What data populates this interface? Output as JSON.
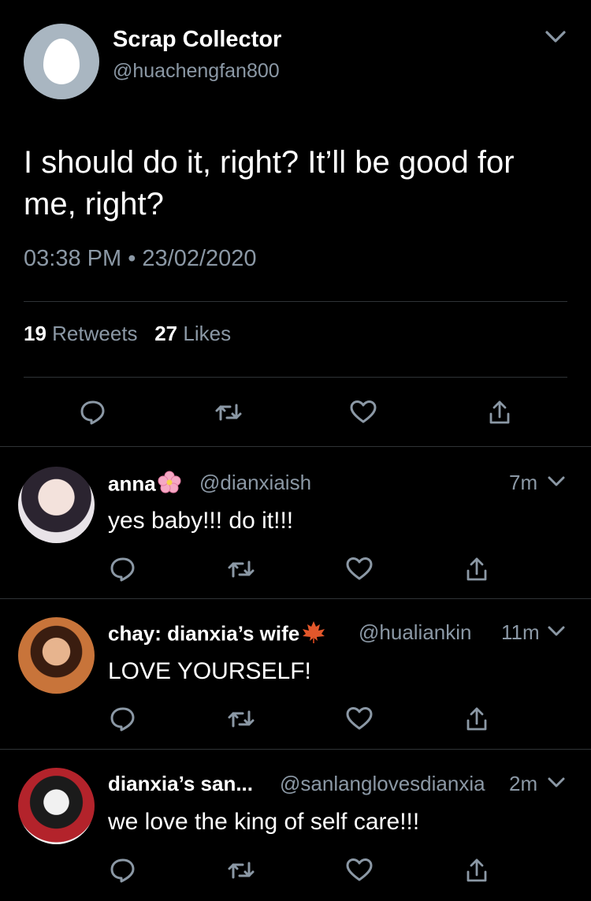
{
  "tweet": {
    "author_name": "Scrap Collector",
    "author_handle": "@huachengfan800",
    "text": "I should do it, right? It’ll be good for me, right?",
    "time": "03:38 PM",
    "separator": "•",
    "date": "23/02/2020",
    "retweet_count": "19",
    "retweet_label": "Retweets",
    "like_count": "27",
    "like_label": "Likes"
  },
  "icons": {
    "reply": "reply-icon",
    "retweet": "retweet-icon",
    "like": "heart-icon",
    "share": "share-icon",
    "more": "chevron-down-icon"
  },
  "colors": {
    "background": "#000000",
    "text": "#ffffff",
    "muted": "#8b98a5",
    "divider": "#2f3336"
  },
  "replies": [
    {
      "name": "anna",
      "emoji": "cherry-blossom",
      "handle": "@dianxiaish",
      "time": "7m",
      "text": "yes baby!!! do it!!!"
    },
    {
      "name": "chay: dianxia’s wife",
      "emoji": "maple-leaf",
      "handle": "@hualiankin",
      "time": "11m",
      "text": "LOVE YOURSELF!"
    },
    {
      "name": "dianxia’s san...",
      "emoji": "",
      "handle": "@sanlanglovesdianxia",
      "time": "2m",
      "text": "we love the king of self care!!!"
    }
  ]
}
